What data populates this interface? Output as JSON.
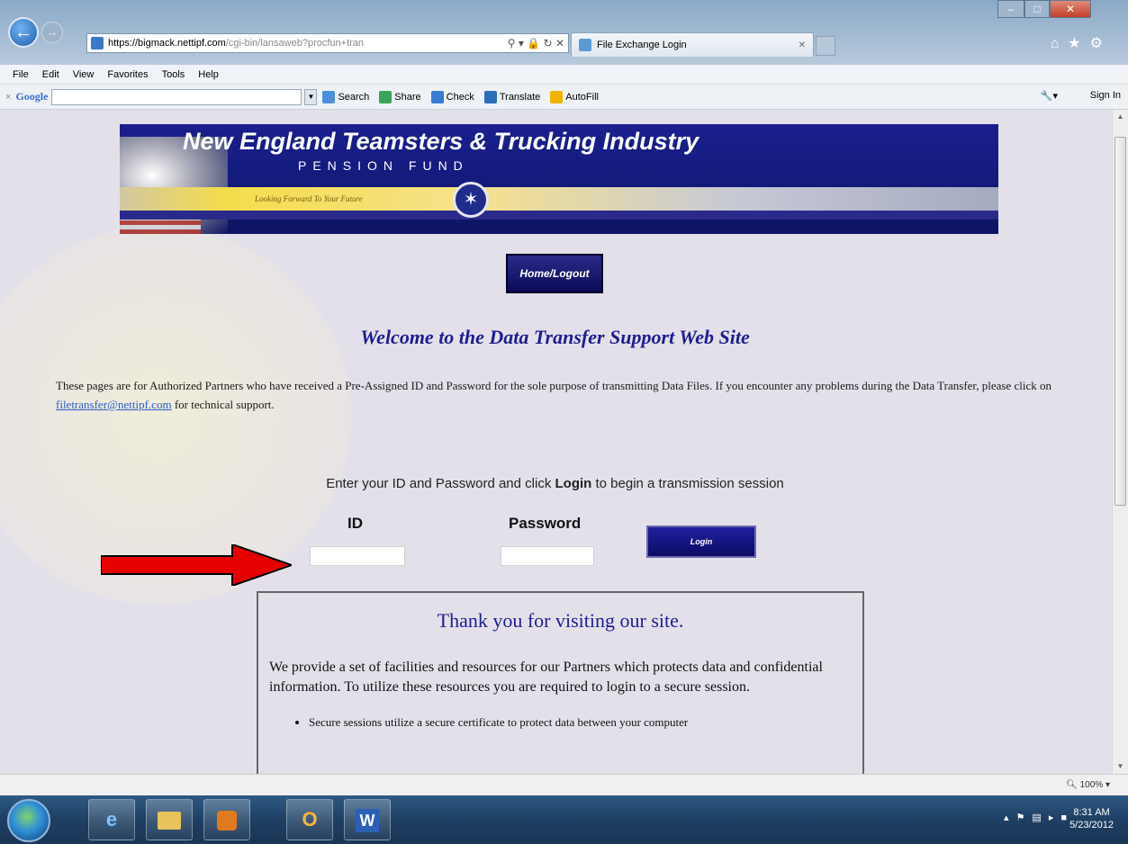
{
  "browser": {
    "url_host": "https://bigmack.nettipf.com",
    "url_rest": "/cgi-bin/lansaweb?procfun+tran",
    "tab_title": "File Exchange Login",
    "menu": [
      "File",
      "Edit",
      "View",
      "Favorites",
      "Tools",
      "Help"
    ],
    "google_toolbar": {
      "logo": "Google",
      "items": [
        "Search",
        "Share",
        "Check",
        "Translate",
        "AutoFill"
      ],
      "sign_in": "Sign In"
    },
    "zoom": "100%"
  },
  "banner": {
    "title": "New England Teamsters & Trucking Industry",
    "subtitle": "PENSION FUND",
    "tagline": "Looking Forward To Your Future"
  },
  "page": {
    "home_button": "Home/Logout",
    "welcome": "Welcome to the Data Transfer Support Web Site",
    "intro_before": "These pages are for Authorized Partners who have received a Pre-Assigned ID and Password for the sole purpose of transmitting Data Files. If you encounter any problems during the Data Transfer, please click on ",
    "intro_link": "filetransfer@nettipf.com",
    "intro_after": " for technical support.",
    "instruction_before": "Enter your ID and Password and click ",
    "instruction_bold": "Login",
    "instruction_after": " to begin a transmission session",
    "id_label": "ID",
    "password_label": "Password",
    "id_value": "",
    "password_value": "",
    "login_button": "Login"
  },
  "thanks_box": {
    "heading": "Thank you for visiting our site.",
    "paragraph": "We provide a set of facilities and resources for our Partners which protects data and confidential information. To utilize these resources you are required to login to a secure session.",
    "bullets": [
      "Secure sessions utilize a secure certificate to protect data between your computer"
    ]
  },
  "taskbar": {
    "clock_time": "8:31 AM",
    "clock_date": "5/23/2012"
  },
  "colors": {
    "banner_navy": "#121a78",
    "heading_blue": "#1d1d92",
    "button_navy": "#0b0b64",
    "arrow_red": "#e60000"
  }
}
